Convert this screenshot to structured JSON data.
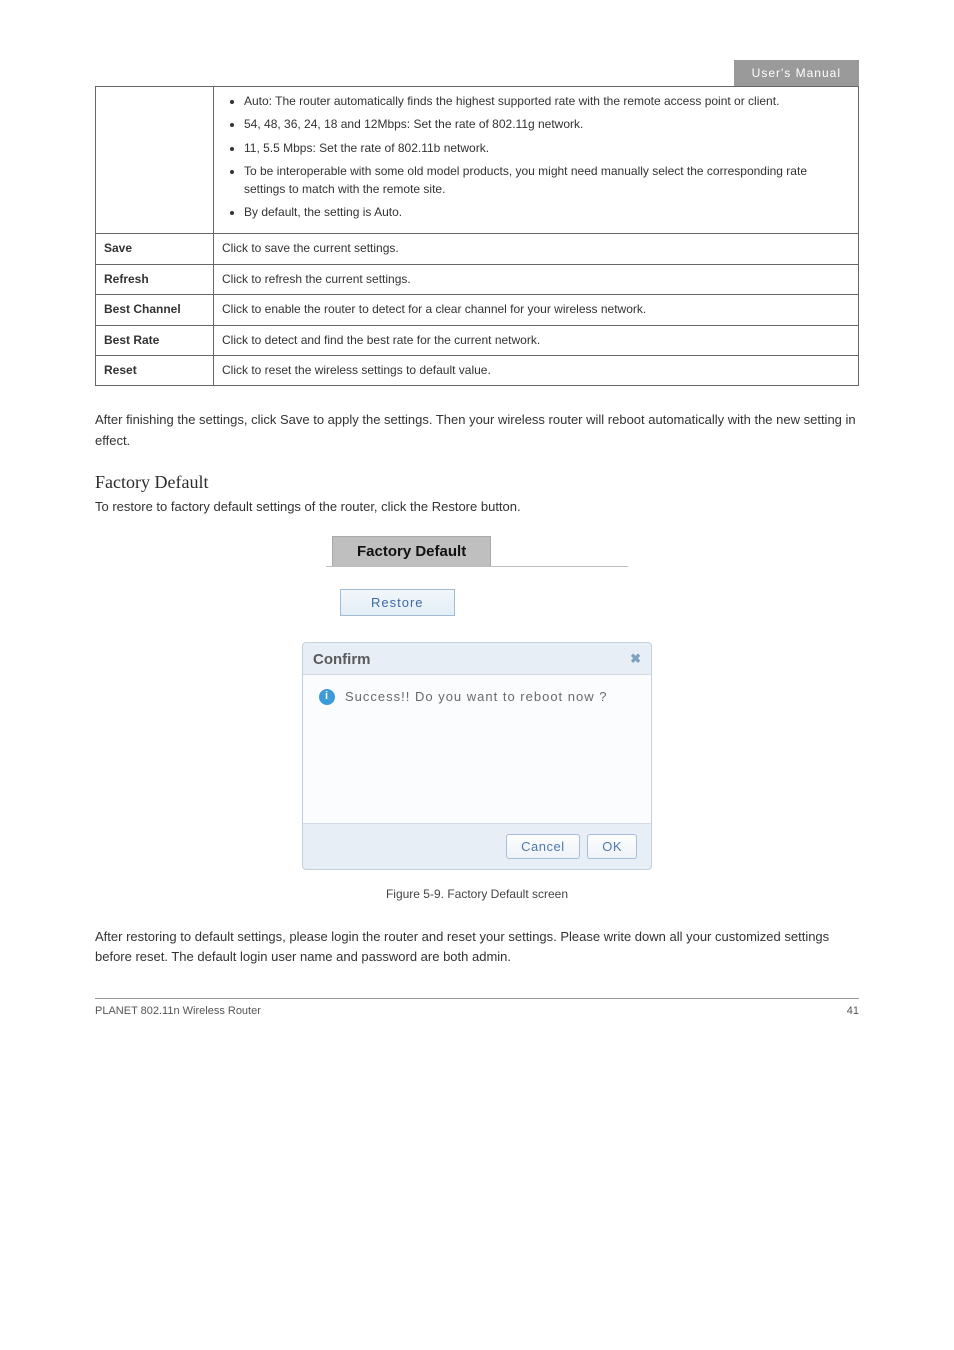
{
  "header": {
    "tag": "User's Manual"
  },
  "table": {
    "rows": [
      {
        "c1": "",
        "bullets": [
          "Auto: The router automatically finds the highest supported rate with the remote access point or client.",
          "54, 48, 36, 24, 18 and 12Mbps: Set the rate of 802.11g network.",
          "11, 5.5 Mbps: Set the rate of 802.11b network.",
          "To be interoperable with some old model products, you might need manually select the corresponding rate settings to match with the remote site.",
          "By default, the setting is Auto."
        ]
      },
      {
        "c1": "Save",
        "c2": "Click to save the current settings."
      },
      {
        "c1": "Refresh",
        "c2": "Click to refresh the current settings."
      },
      {
        "c1": "Best Channel",
        "c2": "Click to enable the router to detect for a clear channel for your wireless network."
      },
      {
        "c1": "Best Rate",
        "c2": "Click to detect and find the best rate for the current network."
      },
      {
        "c1": "Reset",
        "c2": "Click to reset the wireless settings to default value."
      }
    ]
  },
  "para_save": "After finishing the settings, click Save to apply the settings. Then your wireless router will reboot automatically with the new setting in effect.",
  "section": {
    "title": "Factory Default",
    "desc": "To restore to factory default settings of the router, click the Restore button."
  },
  "fd": {
    "tab": "Factory Default",
    "restore": "Restore",
    "dialog": {
      "title": "Confirm",
      "close_glyph": "✖",
      "info_glyph": "i",
      "message": "Success!! Do you want to reboot now ?",
      "cancel": "Cancel",
      "ok": "OK"
    }
  },
  "figure_caption": "Figure 5-9. Factory Default screen",
  "para_login": "After restoring to default settings, please login the router and reset your settings. Please write down all your customized settings before reset. The default login user name and password are both admin.",
  "footer": {
    "left": "PLANET 802.11n Wireless Router",
    "right": "41"
  }
}
